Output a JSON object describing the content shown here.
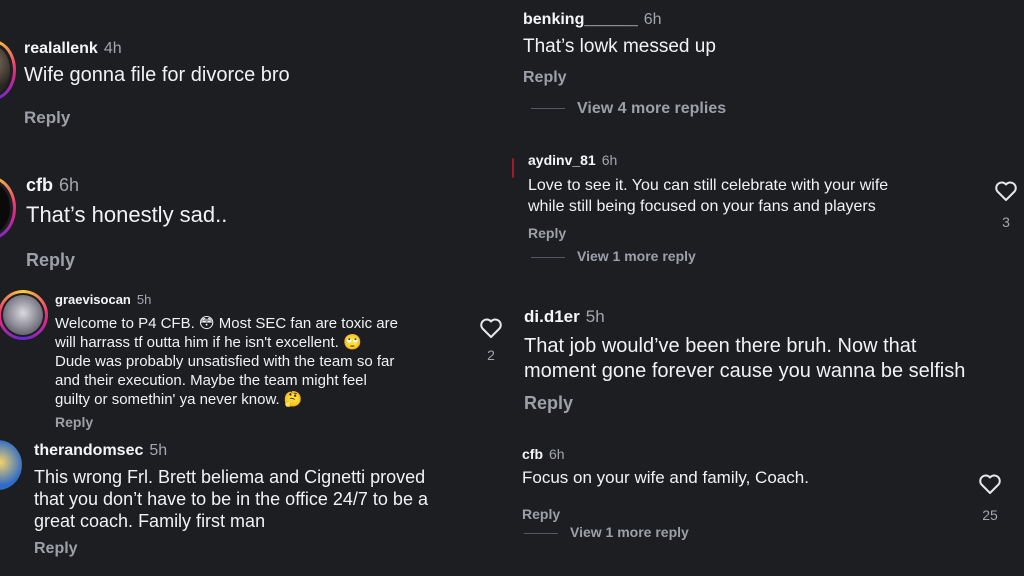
{
  "left_column": {
    "comments": [
      {
        "username": "realallenk",
        "time": "4h",
        "text": "Wife gonna file for divorce bro",
        "reply": "Reply"
      },
      {
        "username": "cfb",
        "time": "6h",
        "text": "That’s honestly sad..",
        "reply": "Reply"
      },
      {
        "username": "graevisocan",
        "time": "5h",
        "lines": [
          "Welcome to P4 CFB. 😳 Most SEC fan are toxic are",
          "will harrass tf outta him if he isn't excellent. 🙄",
          "Dude was probably unsatisfied with the team so far",
          "and their execution. Maybe the team might feel",
          "guilty or somethin' ya never know. 🤔"
        ],
        "reply": "Reply",
        "likes": "2"
      },
      {
        "username": "therandomsec",
        "time": "5h",
        "lines": [
          "This wrong Frl. Brett beliema and Cignetti proved",
          "that you don’t have to be in the office 24/7 to be a",
          "great coach. Family first man"
        ],
        "reply": "Reply"
      }
    ]
  },
  "right_column": {
    "comments": [
      {
        "username": "benking______",
        "time": "6h",
        "text": "That’s lowk messed up",
        "reply": "Reply",
        "more": "View 4 more replies"
      },
      {
        "username": "aydinv_81",
        "time": "6h",
        "lines": [
          "Love to see it. You can still celebrate with your wife",
          "while still being focused on your fans and players"
        ],
        "reply": "Reply",
        "likes": "3",
        "more": "View 1 more reply"
      },
      {
        "username": "di.d1er",
        "time": "5h",
        "lines": [
          "That job would’ve been there bruh. Now that",
          "moment gone forever cause you wanna be selfish"
        ],
        "reply": "Reply"
      },
      {
        "username": "cfb",
        "time": "6h",
        "text": "Focus on your wife and family, Coach.",
        "reply": "Reply",
        "likes": "25",
        "more": "View 1 more reply"
      }
    ]
  },
  "icons": {
    "like": "heart-icon",
    "avatar": "avatar"
  },
  "colors": {
    "background": "#1c1e22",
    "muted_text": "#9da0a7",
    "story_ring_start": "#f9ce34",
    "story_ring_end": "#6228d7"
  }
}
